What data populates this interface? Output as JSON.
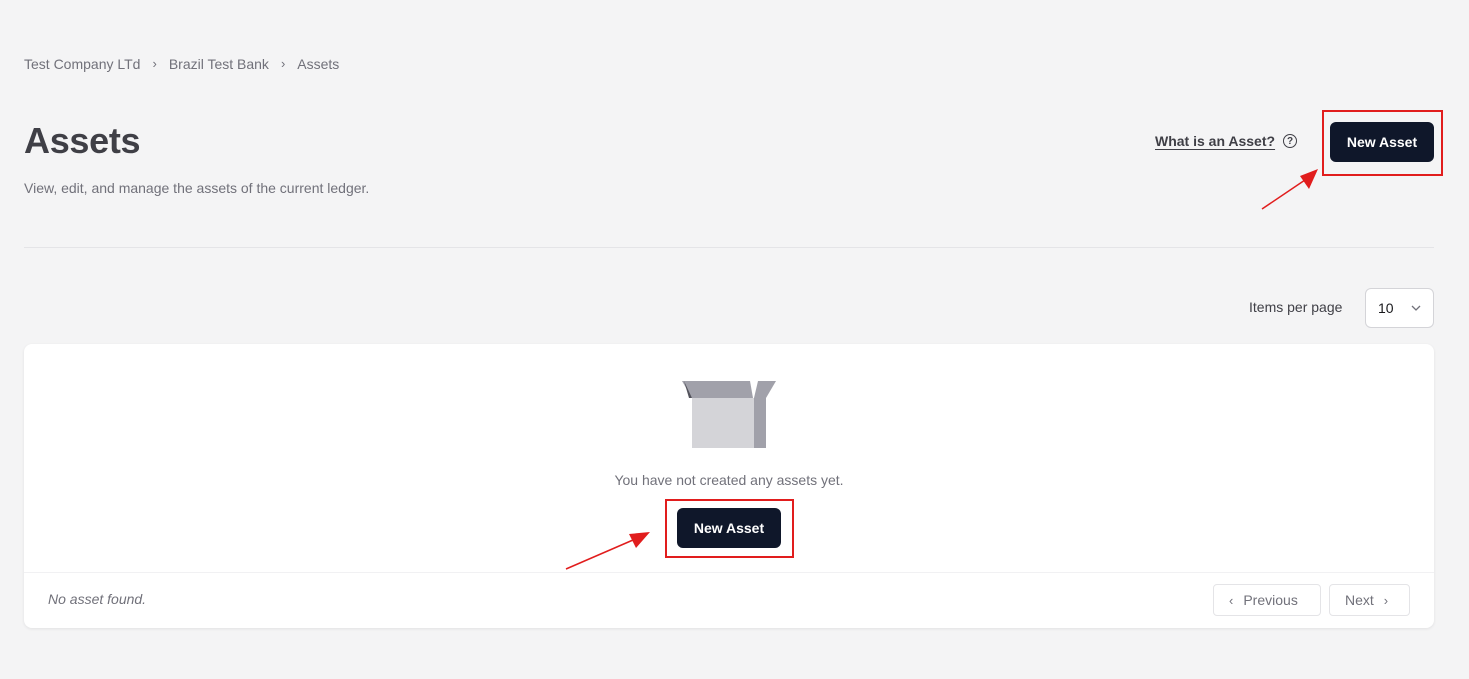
{
  "breadcrumb": {
    "items": [
      "Test Company LTd",
      "Brazil Test Bank",
      "Assets"
    ],
    "separator": "›"
  },
  "header": {
    "title": "Assets",
    "subtitle": "View, edit, and manage the assets of the current ledger.",
    "help_link": "What is an Asset?",
    "help_icon": "?",
    "new_asset_label": "New Asset"
  },
  "pagination_controls": {
    "items_per_page_label": "Items per page",
    "items_per_page_value": "10",
    "chevron": "⌄"
  },
  "empty_state": {
    "message": "You have not created any assets yet.",
    "new_asset_label": "New Asset",
    "icon": "empty-box-icon"
  },
  "footer": {
    "status": "No asset found.",
    "previous_label": "Previous",
    "next_label": "Next",
    "prev_arrow": "‹",
    "next_arrow": "›"
  },
  "colors": {
    "primary": "#0f172a",
    "highlight": "#e11d1d",
    "background": "#f4f4f5"
  }
}
